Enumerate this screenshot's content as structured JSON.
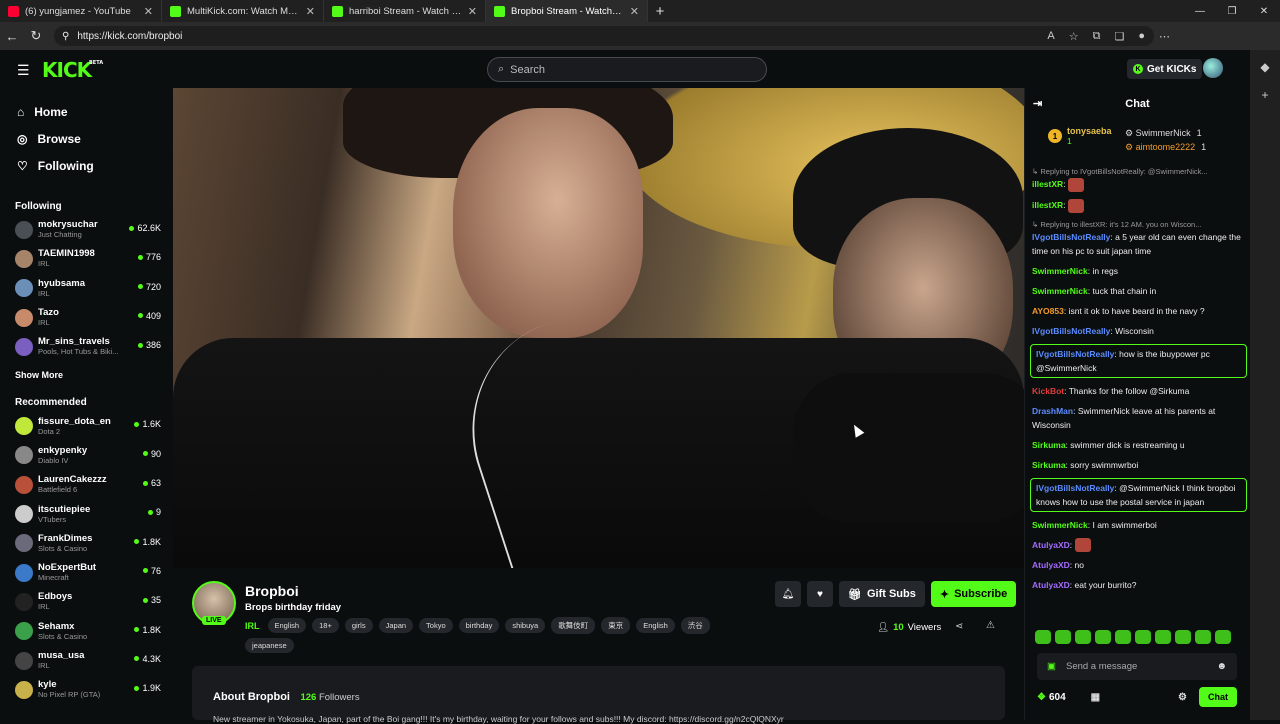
{
  "browser": {
    "tabs": [
      {
        "title": "(6) yungjamez - YouTube",
        "color": "#ff0033"
      },
      {
        "title": "MultiKick.com: Watch Multiple Str...",
        "color": "#53fc18"
      },
      {
        "title": "harriboi Stream - Watch Live on K...",
        "color": "#53fc18"
      },
      {
        "title": "Bropboi Stream - Watch Live...",
        "color": "#53fc18"
      }
    ],
    "url": "https://kick.com/bropboi"
  },
  "header": {
    "logo": "KICK",
    "logo_badge": "BETA",
    "search_placeholder": "Search",
    "get_kicks": "Get KICKs"
  },
  "sidebar": {
    "nav": [
      {
        "label": "Home",
        "icon": "home-icon"
      },
      {
        "label": "Browse",
        "icon": "compass-icon"
      },
      {
        "label": "Following",
        "icon": "heart-icon"
      }
    ],
    "following_title": "Following",
    "following": [
      {
        "name": "mokrysuchar",
        "category": "Just Chatting",
        "viewers": "62.6K",
        "color": "#4a4f56"
      },
      {
        "name": "TAEMIN1998",
        "category": "IRL",
        "viewers": "776",
        "color": "#a6846a"
      },
      {
        "name": "hyubsama",
        "category": "IRL",
        "viewers": "720",
        "color": "#6c8fb8"
      },
      {
        "name": "Tazo",
        "category": "IRL",
        "viewers": "409",
        "color": "#c78a6a"
      },
      {
        "name": "Mr_sins_travels",
        "category": "Pools, Hot Tubs & Biki...",
        "viewers": "386",
        "color": "#7a5ec0"
      }
    ],
    "show_more": "Show More",
    "recommended_title": "Recommended",
    "recommended": [
      {
        "name": "fissure_dota_en",
        "category": "Dota 2",
        "viewers": "1.6K",
        "color": "#c0e83a"
      },
      {
        "name": "enkypenky",
        "category": "Diablo IV",
        "viewers": "90",
        "color": "#888"
      },
      {
        "name": "LaurenCakezzz",
        "category": "Battlefield 6",
        "viewers": "63",
        "color": "#b8503a"
      },
      {
        "name": "itscutiepiee",
        "category": "VTubers",
        "viewers": "9",
        "color": "#ccc"
      },
      {
        "name": "FrankDimes",
        "category": "Slots & Casino",
        "viewers": "1.8K",
        "color": "#6a6a7a"
      },
      {
        "name": "NoExpertBut",
        "category": "Minecraft",
        "viewers": "76",
        "color": "#3a7ac8"
      },
      {
        "name": "Edboys",
        "category": "IRL",
        "viewers": "35",
        "color": "#222"
      },
      {
        "name": "Sehamx",
        "category": "Slots & Casino",
        "viewers": "1.8K",
        "color": "#3aa04a"
      },
      {
        "name": "musa_usa",
        "category": "IRL",
        "viewers": "4.3K",
        "color": "#444"
      },
      {
        "name": "kyle",
        "category": "No Pixel RP (GTA)",
        "viewers": "1.9K",
        "color": "#c8b04a"
      }
    ]
  },
  "stream": {
    "channel": "Bropboi",
    "live": "LIVE",
    "title": "Brops birthday friday",
    "category": "IRL",
    "tags": [
      "English",
      "18+",
      "girls",
      "Japan",
      "Tokyo",
      "birthday",
      "shibuya",
      "歌舞伎町",
      "東京",
      "English",
      "渋谷",
      "jeapanese"
    ],
    "gift_subs": "Gift Subs",
    "subscribe": "Subscribe",
    "viewers": "10",
    "viewers_label": "Viewers",
    "about_title": "About Bropboi",
    "followers": "126",
    "followers_label": "Followers",
    "description": "New streamer in Yokosuka, Japan, part of the Boi gang!!! It's my birthday, waiting for your follows and subs!!! My discord: https://discord.gg/n2cQlQNXyr"
  },
  "chat": {
    "title": "Chat",
    "pinned": [
      {
        "rank": "1",
        "name": "tonysaeba",
        "count": "1"
      },
      {
        "name": "SwimmerNick",
        "count": "1"
      },
      {
        "name": "aimtoome2222",
        "count": "1"
      }
    ],
    "messages": [
      {
        "type": "reply",
        "text": "↳ Replying to IVgotBillsNotReally: @SwimmerNick..."
      },
      {
        "user": "illestXR",
        "color": "#53fc18",
        "text": ""
      },
      {
        "user": "illestXR",
        "color": "#53fc18",
        "text": ""
      },
      {
        "type": "reply",
        "text": "↳ Replying to illestXR: it's 12 AM. you on Wiscon..."
      },
      {
        "user": "IVgotBillsNotReally",
        "color": "#5b8cff",
        "text": "a 5 year old can even change the time on his pc to suit japan time"
      },
      {
        "user": "SwimmerNick",
        "color": "#53fc18",
        "text": "in regs"
      },
      {
        "user": "SwimmerNick",
        "color": "#53fc18",
        "text": "tuck that chain in"
      },
      {
        "user": "AYO853",
        "color": "#f39c2b",
        "text": "isnt it ok to have beard in the navy ?"
      },
      {
        "user": "IVgotBillsNotReally",
        "color": "#5b8cff",
        "text": "Wisconsin"
      },
      {
        "user": "IVgotBillsNotReally",
        "color": "#5b8cff",
        "text": "how is the ibuypower pc @SwimmerNick",
        "highlight": true
      },
      {
        "user": "KickBot",
        "color": "#e23b3b",
        "text": "Thanks for the follow @Sirkuma"
      },
      {
        "user": "DrashMan",
        "color": "#5b8cff",
        "text": "SwimmerNick leave at his parents at Wisconsin"
      },
      {
        "user": "Sirkuma",
        "color": "#53fc18",
        "text": "swimmer dick is restreaming u"
      },
      {
        "user": "Sirkuma",
        "color": "#53fc18",
        "text": "sorry swimmwrboi"
      },
      {
        "user": "IVgotBillsNotReally",
        "color": "#5b8cff",
        "text": "@SwimmerNick I think bropboi knows how to use the postal service in japan",
        "highlight": true
      },
      {
        "user": "SwimmerNick",
        "color": "#53fc18",
        "text": "I am swimmerboi"
      },
      {
        "user": "AtulyaXD",
        "color": "#a36bff",
        "text": ""
      },
      {
        "user": "AtulyaXD",
        "color": "#a36bff",
        "text": "no"
      },
      {
        "user": "AtulyaXD",
        "color": "#a36bff",
        "text": "eat your burrito?"
      }
    ],
    "send_placeholder": "Send a message",
    "points": "604",
    "chat_button": "Chat"
  }
}
